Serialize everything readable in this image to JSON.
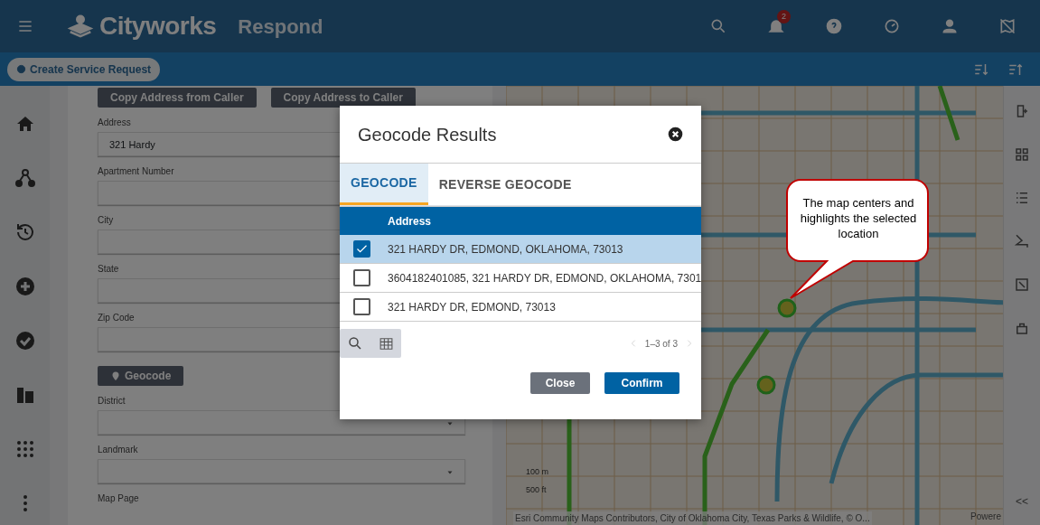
{
  "header": {
    "logo": "Cityworks",
    "app_name": "Respond",
    "notification_count": "2"
  },
  "subbar": {
    "create_button": "Create Service Request"
  },
  "form": {
    "copy_buttons": [
      "Copy Address from Caller",
      "Copy Address to Caller"
    ],
    "fields": [
      {
        "label": "Address",
        "value": "321 Hardy",
        "kind": "text"
      },
      {
        "label": "Apartment Number",
        "kind": "text"
      },
      {
        "label": "City",
        "kind": "text"
      },
      {
        "label": "State",
        "kind": "text"
      },
      {
        "label": "Zip Code",
        "kind": "text"
      }
    ],
    "geocode_button": "Geocode",
    "more_fields": [
      {
        "label": "District",
        "kind": "select"
      },
      {
        "label": "Landmark",
        "kind": "select"
      },
      {
        "label": "Map Page",
        "kind": "label"
      }
    ]
  },
  "map": {
    "scale": [
      "100 m",
      "500 ft"
    ],
    "attribution": "Esri Community Maps Contributors, City of Oklahoma City, Texas Parks & Wildlife, © O...",
    "powered": "Powere",
    "collapse": "<<"
  },
  "callout": {
    "text": "The map centers and highlights the selected location"
  },
  "modal": {
    "title": "Geocode Results",
    "tabs": [
      {
        "label": "GEOCODE",
        "selected": true
      },
      {
        "label": "REVERSE GEOCODE",
        "selected": false
      }
    ],
    "column": "Address",
    "rows": [
      {
        "address": "321 HARDY DR, EDMOND, OKLAHOMA, 73013",
        "selected": true
      },
      {
        "address": "3604182401085, 321 HARDY DR, EDMOND, OKLAHOMA, 7301",
        "selected": false
      },
      {
        "address": "321 HARDY DR, EDMOND, 73013",
        "selected": false
      }
    ],
    "pager": "1–3 of 3",
    "buttons": [
      {
        "label": "Close",
        "kind": "secondary"
      },
      {
        "label": "Confirm",
        "kind": "primary"
      }
    ]
  }
}
